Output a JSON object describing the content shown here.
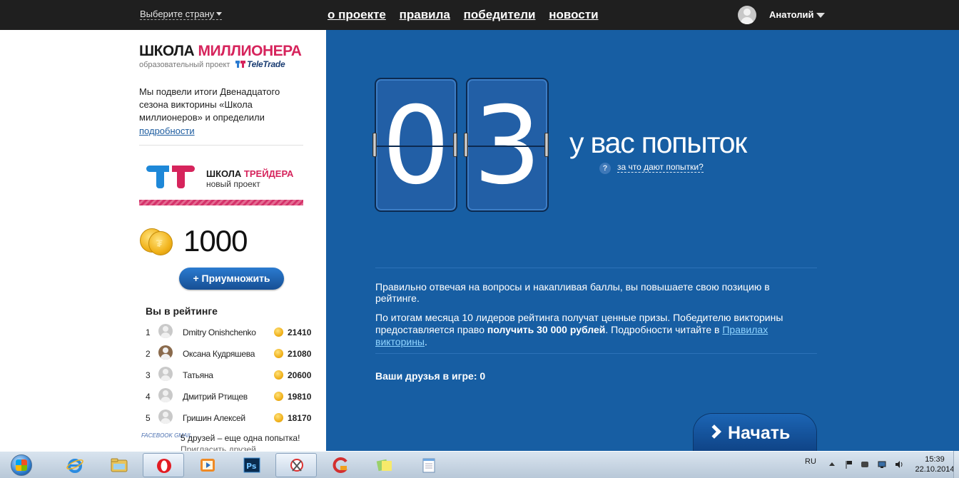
{
  "topbar": {
    "country_select": "Выберите страну",
    "nav": [
      "о проекте",
      "правила",
      "победители",
      "новости"
    ],
    "user_name": "Анатолий"
  },
  "left": {
    "logo_part1": "ШКОЛА",
    "logo_part2": "МИЛЛИОНЕРА",
    "logo_subtitle": "образовательный проект",
    "logo_brand": "TeleTrade",
    "news_text": "Мы подвели итоги Двенадцатого сезона викторины «Школа миллионеров» и определили",
    "news_link": "подробности",
    "trader_part1": "ШКОЛА",
    "trader_part2": "ТРЕЙДЕРА",
    "trader_sub": "новый проект",
    "balance": "1000",
    "multiply_button": "+ Приумножить",
    "rating_title": "Вы в рейтинге",
    "rating": [
      {
        "rank": "1",
        "name": "Dmitry Onishchenko",
        "points": "21410"
      },
      {
        "rank": "2",
        "name": "Оксана Кудряшева",
        "points": "21080"
      },
      {
        "rank": "3",
        "name": "Татьяна",
        "points": "20600"
      },
      {
        "rank": "4",
        "name": "Дмитрий Ртищев",
        "points": "19810"
      },
      {
        "rank": "5",
        "name": "Гришин Алексей",
        "points": "18170"
      }
    ],
    "friends_logo": "FACEBOOK GMAIL",
    "friends_offer": "5 друзей – еще одна попытка!",
    "friends_offer2": "Пригласить друзей"
  },
  "main": {
    "digit1": "0",
    "digit2": "3",
    "attempts_label": "у вас попыток",
    "help_icon": "?",
    "help_link": "за что дают попытки?",
    "para1": "Правильно отвечая на вопросы и накапливая баллы, вы повышаете свою позицию в рейтинге.",
    "para2_a": "По итогам месяца 10 лидеров рейтинга получат ценные призы. Победителю викторины предоставляется право ",
    "para2_bold": "получить 30 000 рублей",
    "para2_b": ". Подробности читайте в ",
    "para2_link": "Правилах викторины",
    "para2_end": ".",
    "friends_in_game": "Ваши друзья в игре: 0",
    "start_button": "Начать"
  },
  "taskbar": {
    "lang": "RU",
    "time": "15:39",
    "date": "22.10.2014",
    "apps": [
      "ie-icon",
      "explorer-icon",
      "opera-icon",
      "media-player-icon",
      "photoshop-icon",
      "snipping-icon",
      "ccleaner-icon",
      "sticky-notes-icon",
      "notepad-icon"
    ]
  },
  "colors": {
    "main_bg": "#175ea3",
    "topbar_bg": "#1f1f1f",
    "accent_red": "#d6245c",
    "link_blue": "#1e5da0"
  }
}
